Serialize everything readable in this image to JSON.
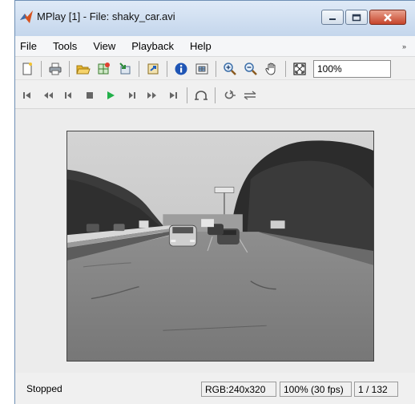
{
  "window": {
    "title": "MPlay [1] - File: shaky_car.avi"
  },
  "menu": {
    "items": [
      "File",
      "Tools",
      "View",
      "Playback",
      "Help"
    ],
    "overflow_arrow": "»"
  },
  "toolbar": {
    "zoom_value": "100%"
  },
  "status": {
    "state": "Stopped",
    "color_info": "RGB:240x320",
    "rate": "100% (30 fps)",
    "frame": "1 / 132"
  }
}
